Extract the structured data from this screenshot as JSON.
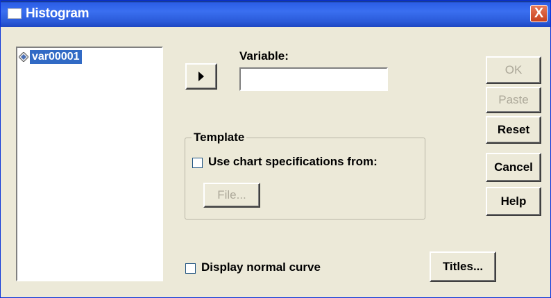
{
  "window": {
    "title": "Histogram",
    "close_glyph": "X"
  },
  "variables_list": {
    "items": [
      {
        "label": "var00001",
        "icon": "scale-variable-icon",
        "selected": true
      }
    ]
  },
  "variable_field": {
    "label": "Variable:",
    "value": ""
  },
  "template": {
    "group_title": "Template",
    "use_spec_label": "Use chart specifications from:",
    "use_spec_checked": false,
    "file_button": "File..."
  },
  "display_normal_curve": {
    "label": "Display normal curve",
    "checked": false
  },
  "buttons": {
    "ok": "OK",
    "paste": "Paste",
    "reset": "Reset",
    "cancel": "Cancel",
    "help": "Help",
    "titles": "Titles..."
  },
  "colors": {
    "titlebar": "#2b5de6",
    "selection": "#316ac5",
    "dialog_bg": "#ece9d8",
    "disabled_text": "#aca899"
  }
}
